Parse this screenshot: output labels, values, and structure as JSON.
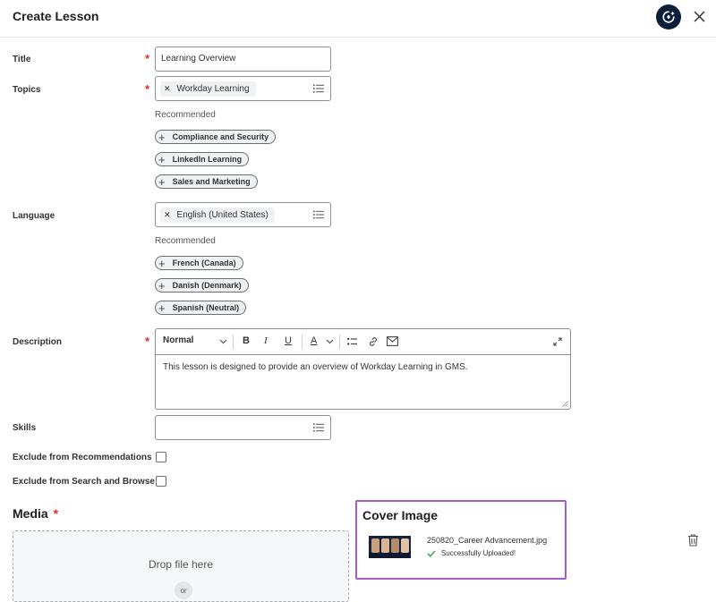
{
  "header": {
    "title": "Create Lesson",
    "assist_icon": "assistant-sparkle-icon",
    "close_icon": "close-icon"
  },
  "form": {
    "title": {
      "label": "Title",
      "required_mark": "*",
      "value": "Learning Overview"
    },
    "topics": {
      "label": "Topics",
      "required_mark": "*",
      "selected": "Workday Learning",
      "recommended_label": "Recommended",
      "recommended": [
        "Compliance and Security",
        "LinkedIn Learning",
        "Sales and Marketing"
      ]
    },
    "language": {
      "label": "Language",
      "selected": "English (United States)",
      "recommended_label": "Recommended",
      "recommended": [
        "French (Canada)",
        "Danish (Denmark)",
        "Spanish (Neutral)"
      ]
    },
    "description": {
      "label": "Description",
      "required_mark": "*",
      "toolbar": {
        "format": "Normal",
        "bold": "B",
        "italic": "I",
        "underline": "U",
        "font_color": "A"
      },
      "value": "This lesson is designed to provide an overview of Workday Learning in GMS."
    },
    "skills": {
      "label": "Skills",
      "value": ""
    },
    "exclude_recommendations": {
      "label": "Exclude from Recommendations",
      "checked": false
    },
    "exclude_search": {
      "label": "Exclude from Search and Browse",
      "checked": false
    }
  },
  "media": {
    "title": "Media",
    "required_mark": "*",
    "drop_text": "Drop file here",
    "or_text": "or"
  },
  "cover_image": {
    "title": "Cover Image",
    "file_name": "250820_Career Advancement.jpg",
    "status": "Successfully Uploaded!",
    "status_color": "#3a9d4a",
    "accent_color": "#a55cc8"
  }
}
